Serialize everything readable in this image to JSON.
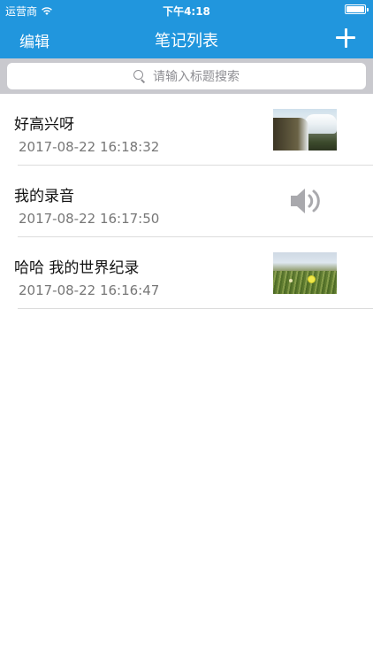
{
  "status_bar": {
    "carrier": "运营商",
    "time": "下午4:18"
  },
  "navbar": {
    "edit_label": "编辑",
    "title": "笔记列表",
    "add_icon": "plus-icon"
  },
  "search": {
    "placeholder": "请输入标题搜索",
    "icon": "search-icon"
  },
  "notes": [
    {
      "title": "好高兴呀",
      "time": "2017-08-22 16:18:32",
      "thumbnail": "waterfall-photo"
    },
    {
      "title": "我的录音",
      "time": "2017-08-22 16:17:50",
      "thumbnail": "speaker-icon"
    },
    {
      "title": "哈哈 我的世界纪录",
      "time": "2017-08-22 16:16:47",
      "thumbnail": "flower-photo"
    }
  ],
  "colors": {
    "header": "#2196dd",
    "search_bg": "#c9c9ce",
    "speaker_gray": "#a9a9ad"
  }
}
